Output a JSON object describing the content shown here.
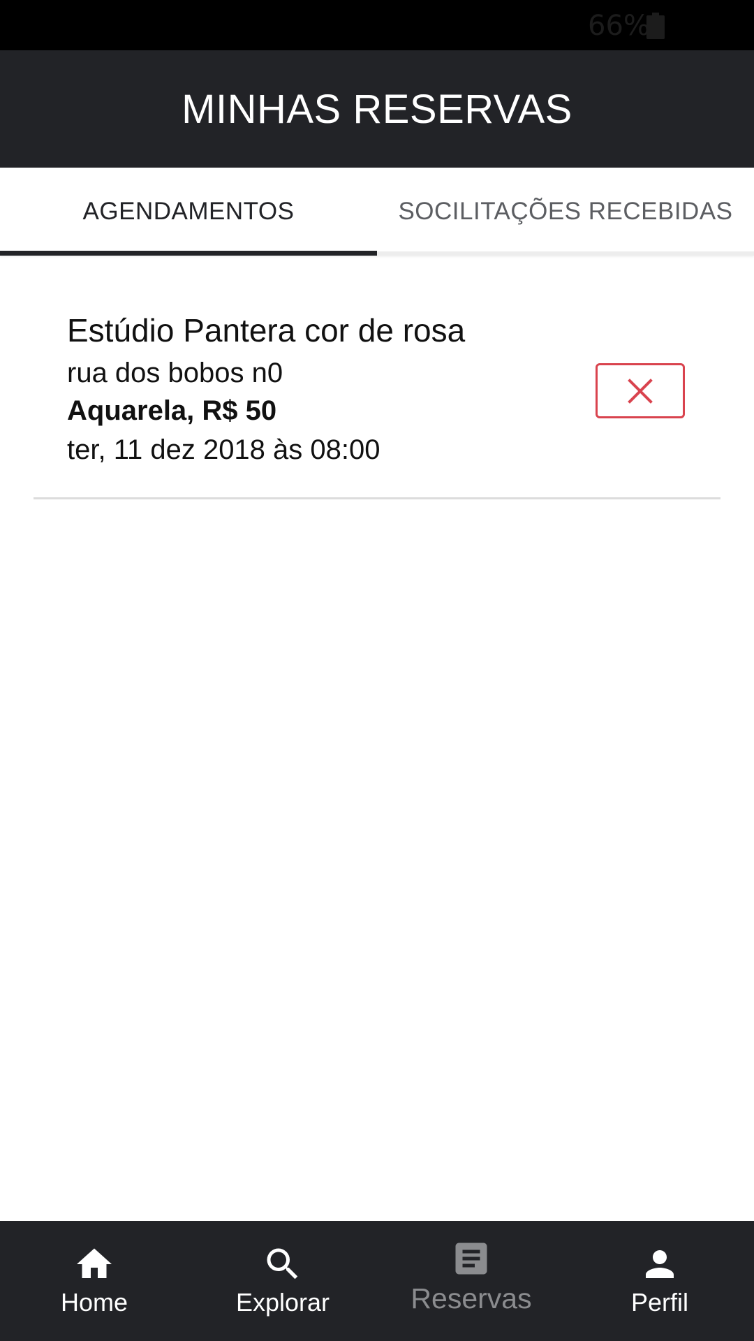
{
  "status_bar": {
    "battery": "66%"
  },
  "header": {
    "title": "MINHAS RESERVAS"
  },
  "tabs": [
    {
      "label": "AGENDAMENTOS",
      "selected": true
    },
    {
      "label": "SOCILITAÇÕES RECEBIDAS",
      "selected": false
    }
  ],
  "bookings": [
    {
      "studio": "Estúdio Pantera cor de rosa",
      "address": "rua dos bobos n0",
      "service": "Aquarela, R$ 50",
      "datetime": "ter, 11 dez 2018 às 08:00",
      "cancel_icon": "close-icon"
    }
  ],
  "bottom_nav": [
    {
      "label": "Home",
      "icon": "home-icon",
      "active": false
    },
    {
      "label": "Explorar",
      "icon": "search-icon",
      "active": false
    },
    {
      "label": "Reservas",
      "icon": "reservations-icon",
      "active": true
    },
    {
      "label": "Perfil",
      "icon": "person-icon",
      "active": false
    }
  ],
  "colors": {
    "bar_background": "#222327",
    "cancel_red": "#d9434e",
    "inactive_nav": "#8b8c8f"
  }
}
